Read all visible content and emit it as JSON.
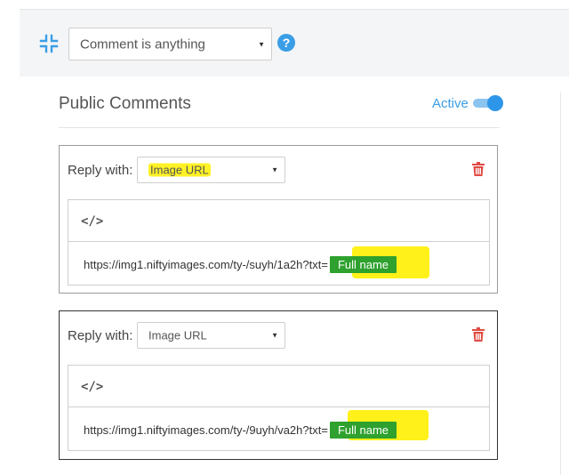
{
  "toolbar": {
    "collapse_icon": "collapse-icon",
    "condition_select_value": "Comment is anything",
    "help_icon": "help-icon",
    "help_glyph": "?"
  },
  "section": {
    "title": "Public Comments",
    "active_label": "Active",
    "active_on": true
  },
  "replies": [
    {
      "label": "Reply with:",
      "type_value": "Image URL",
      "type_highlighted": true,
      "code_icon": "code-icon",
      "code_glyph": "</>",
      "url_text": "https://img1.niftyimages.com/ty-/suyh/1a2h?txt=",
      "tag_label": "Full name"
    },
    {
      "label": "Reply with:",
      "type_value": "Image URL",
      "type_highlighted": false,
      "code_icon": "code-icon",
      "code_glyph": "</>",
      "url_text": "https://img1.niftyimages.com/ty-/9uyh/va2h?txt=",
      "tag_label": "Full name"
    }
  ],
  "colors": {
    "accent": "#3a9ee6",
    "tag_green": "#2ea12e",
    "trash_red": "#e04b43",
    "highlight_yellow": "#fff000"
  }
}
